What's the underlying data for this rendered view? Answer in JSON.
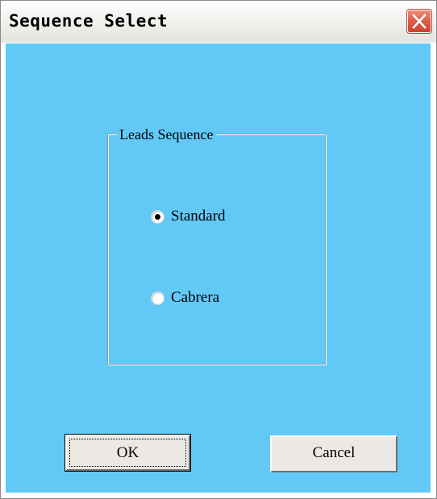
{
  "window": {
    "title": "Sequence Select"
  },
  "group": {
    "label": "Leads Sequence"
  },
  "options": [
    {
      "label": "Standard",
      "selected": true
    },
    {
      "label": "Cabrera",
      "selected": false
    }
  ],
  "buttons": {
    "ok": "OK",
    "cancel": "Cancel"
  },
  "icons": {
    "close": "close-icon",
    "radio": "radio-icon"
  },
  "colors": {
    "client_background": "#62c9f7",
    "close_button": "#dd5a43",
    "button_face": "#ece9e4"
  }
}
